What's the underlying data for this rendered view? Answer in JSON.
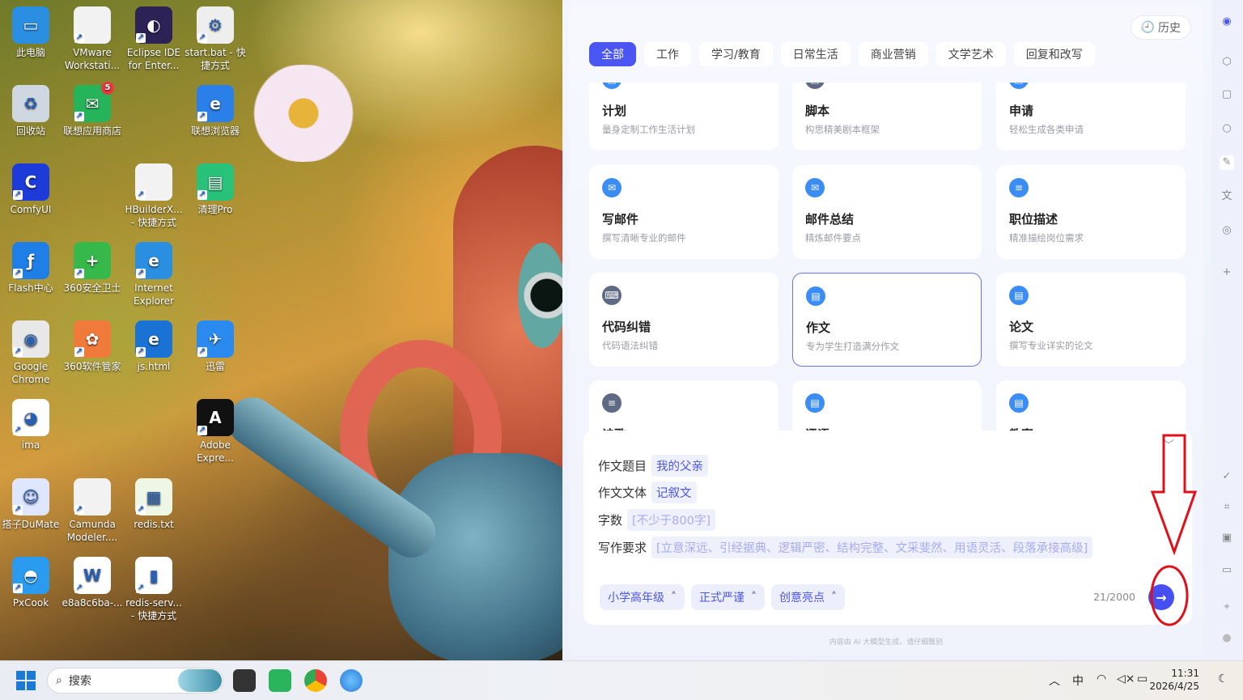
{
  "desktop": {
    "icons": [
      {
        "label": "此电脑",
        "color": "#2a8fe0",
        "symbol": "▭"
      },
      {
        "label": "VMware Workstati...",
        "color": "#f2f2f2",
        "symbol": ""
      },
      {
        "label": "Eclipse IDE for Enter...",
        "color": "#2c2255",
        "symbol": "◐"
      },
      {
        "label": "start.bat - 快捷方式",
        "color": "#eeeeee",
        "symbol": "⚙"
      },
      {
        "label": "回收站",
        "color": "#cfd8e0",
        "symbol": "♻"
      },
      {
        "label": "联想应用商店",
        "color": "#25b45a",
        "symbol": "✉",
        "badge": "5"
      },
      {
        "label": "联想浏览器",
        "color": "#2a7fe8",
        "symbol": "e"
      },
      {
        "label": "ComfyUI",
        "color": "#1d3bd8",
        "symbol": "C"
      },
      {
        "label": "HBuilderX... - 快捷方式",
        "color": "#f2f2f2",
        "symbol": ""
      },
      {
        "label": "清理Pro",
        "color": "#28c27a",
        "symbol": "▤"
      },
      {
        "label": "Flash中心",
        "color": "#1f7fe6",
        "symbol": "ƒ"
      },
      {
        "label": "360安全卫士",
        "color": "#36b94a",
        "symbol": "+"
      },
      {
        "label": "Internet Explorer",
        "color": "#2a8fe0",
        "symbol": "e"
      },
      {
        "label": "Google Chrome",
        "color": "#e8e8e8",
        "symbol": "◉"
      },
      {
        "label": "360软件管家",
        "color": "#f07a3a",
        "symbol": "✿"
      },
      {
        "label": "js.html",
        "color": "#1a72d4",
        "symbol": "e"
      },
      {
        "label": "迅雷",
        "color": "#2b8af0",
        "symbol": "✈"
      },
      {
        "label": "ima",
        "color": "#ffffff",
        "symbol": "◕"
      },
      {
        "label": "Adobe Expre...",
        "color": "#111111",
        "symbol": "A"
      },
      {
        "label": "搭子DuMate",
        "color": "#dfe6ff",
        "symbol": "☺"
      },
      {
        "label": "Camunda Modeler....",
        "color": "#f2f2f2",
        "symbol": ""
      },
      {
        "label": "redis.txt",
        "color": "#eef7e6",
        "symbol": "▦"
      },
      {
        "label": "PxCook",
        "color": "#2b9bf0",
        "symbol": "◓"
      },
      {
        "label": "e8a8c6ba-...",
        "color": "#ffffff",
        "symbol": "W"
      },
      {
        "label": "redis-serv... - 快捷方式",
        "color": "#ffffff",
        "symbol": "▮"
      }
    ]
  },
  "app": {
    "history_label": "历史",
    "tabs": [
      "全部",
      "工作",
      "学习/教育",
      "日常生活",
      "商业营销",
      "文学艺术",
      "回复和改写"
    ],
    "cards": [
      {
        "title": "计划",
        "desc": "量身定制工作生活计划"
      },
      {
        "title": "脚本",
        "desc": "构思精美剧本框架"
      },
      {
        "title": "申请",
        "desc": "轻松生成各类申请"
      },
      {
        "title": "写邮件",
        "desc": "撰写清晰专业的邮件",
        "icon": "✉"
      },
      {
        "title": "邮件总结",
        "desc": "精炼邮件要点",
        "icon": "✉"
      },
      {
        "title": "职位描述",
        "desc": "精准描绘岗位需求",
        "icon": "≡"
      },
      {
        "title": "代码纠错",
        "desc": "代码语法纠错",
        "icon": "⌨"
      },
      {
        "title": "作文",
        "desc": "专为学生打造满分作文",
        "icon": "▤"
      },
      {
        "title": "论文",
        "desc": "撰写专业详实的论文",
        "icon": "▤"
      },
      {
        "title": "诗歌",
        "desc": "",
        "icon": "≡"
      },
      {
        "title": "评语",
        "desc": "",
        "icon": "▤"
      },
      {
        "title": "教案",
        "desc": "",
        "icon": "▤"
      }
    ],
    "form": {
      "topic_label": "作文题目",
      "topic_value": "我的父亲",
      "style_label": "作文文体",
      "style_value": "记叙文",
      "words_label": "字数",
      "words_placeholder": "[不少于800字]",
      "req_label": "写作要求",
      "req_placeholder": "[立意深远、引经据典、逻辑严密、结构完整、文采斐然、用语灵活、段落承接高级]"
    },
    "options": [
      "小学高年级",
      "正式严谨",
      "创意亮点"
    ],
    "char_count": "21/2000",
    "footnote": "内容由 AI 大模型生成，请仔细甄别"
  },
  "taskbar": {
    "search_placeholder": "搜索",
    "ime": "中",
    "time": "11:31",
    "date": "2026/4/25"
  },
  "colors": {
    "accent": "#4b55f2",
    "annotation": "#e0101a"
  }
}
